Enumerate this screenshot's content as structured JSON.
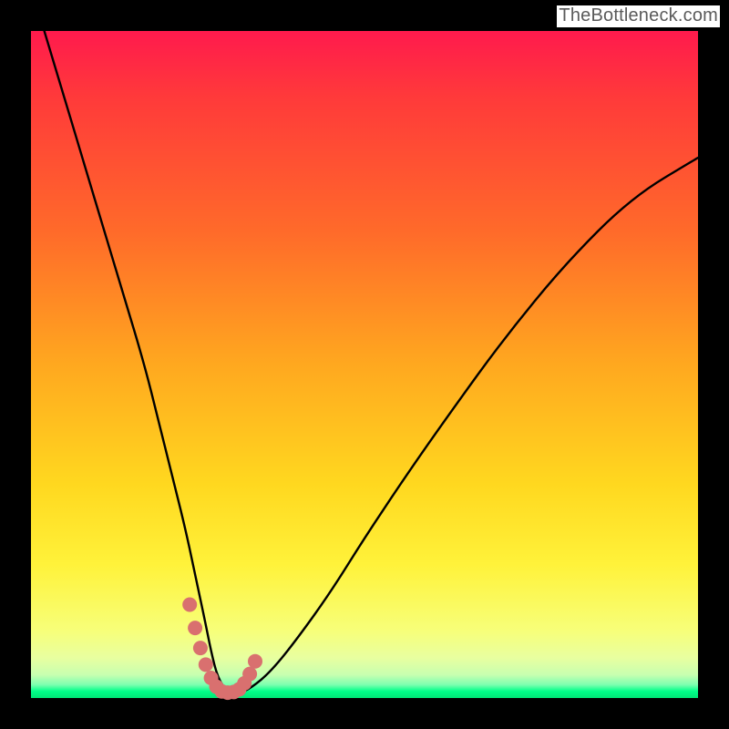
{
  "watermark": "TheBottleneck.com",
  "chart_data": {
    "type": "line",
    "title": "",
    "xlabel": "",
    "ylabel": "",
    "xlim": [
      0,
      100
    ],
    "ylim": [
      0,
      100
    ],
    "grid": false,
    "annotations": [],
    "series": [
      {
        "name": "bottleneck-curve",
        "color": "#000000",
        "x": [
          2,
          5,
          8,
          11,
          14,
          17,
          19,
          21,
          23,
          24.5,
          26,
          27,
          28,
          29.5,
          31,
          33,
          36,
          40,
          45,
          50,
          56,
          63,
          71,
          80,
          90,
          100
        ],
        "values": [
          100,
          90,
          80,
          70,
          60,
          50,
          42,
          34,
          26,
          19,
          12,
          7,
          3,
          0.8,
          0.6,
          1.5,
          4,
          9,
          16,
          24,
          33,
          43,
          54,
          65,
          75,
          81
        ]
      },
      {
        "name": "bottleneck-zone-marker",
        "color": "#d9706f",
        "x": [
          23.8,
          24.6,
          25.4,
          26.2,
          27.0,
          27.8,
          28.6,
          29.5,
          30.4,
          31.2,
          32.0,
          32.8,
          33.6
        ],
        "values": [
          14.0,
          10.5,
          7.5,
          5.0,
          3.0,
          1.7,
          1.0,
          0.8,
          0.9,
          1.3,
          2.2,
          3.6,
          5.5
        ]
      }
    ],
    "marker_radius_px": 8
  },
  "colors": {
    "background": "#000000",
    "curve": "#000000",
    "marker": "#d9706f",
    "gradient_top": "#ff1a4d",
    "gradient_bottom": "#00e676"
  }
}
